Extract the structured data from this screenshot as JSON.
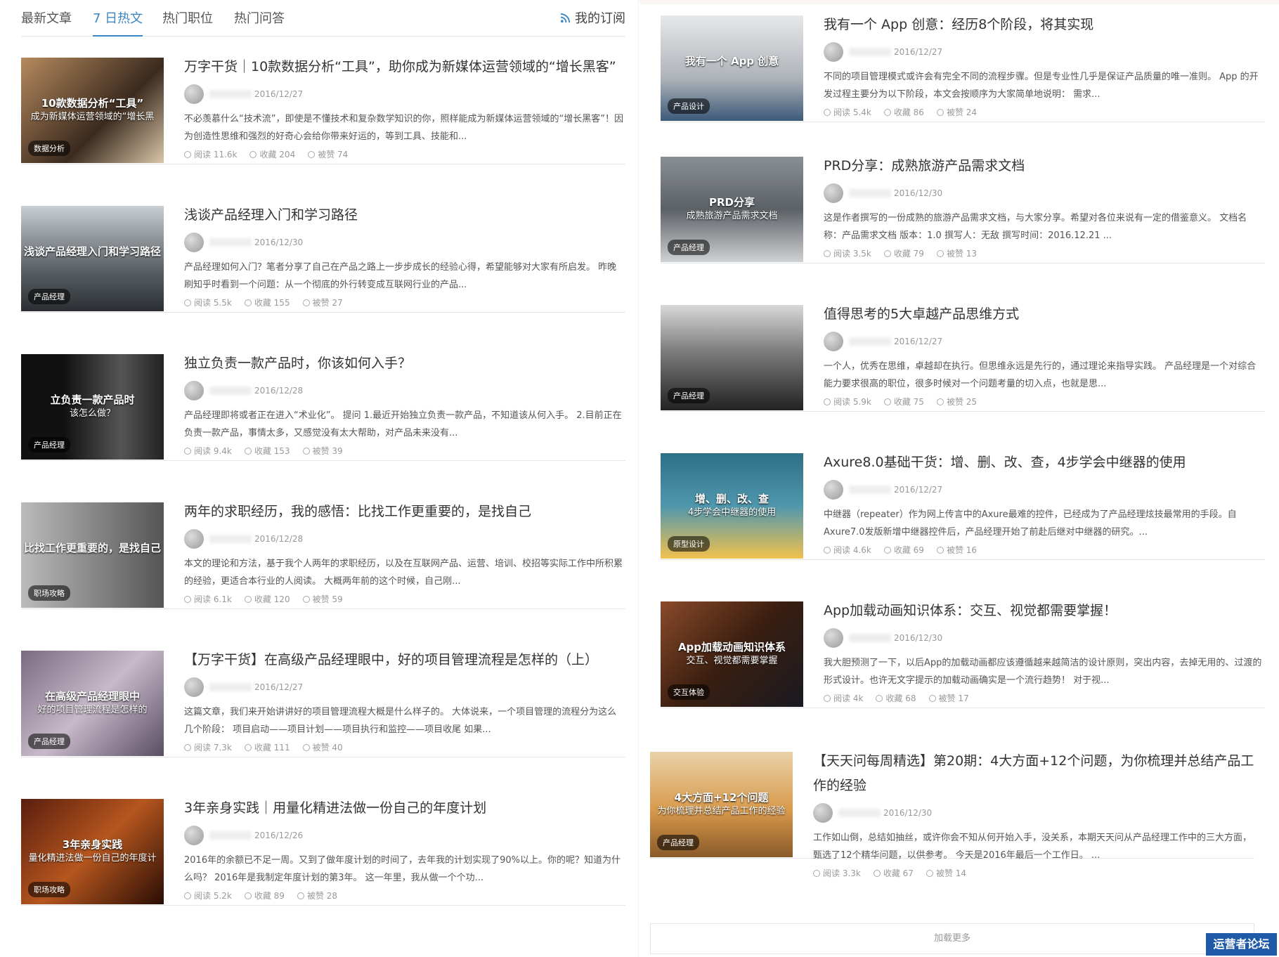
{
  "tabs": [
    "最新文章",
    "7 日热文",
    "热门职位",
    "热门问答"
  ],
  "subscribe": "我的订阅",
  "load_more": "加载更多",
  "logo_text": "运营者论坛",
  "left": [
    {
      "title": "万字干货｜10款数据分析“工具”，助你成为新媒体运营领域的“增长黑客”",
      "date": "2016/12/27",
      "summary": "不必羡慕什么“技术流”，即使是不懂技术和复杂数学知识的你，照样能成为新媒体运营领域的“增长黑客”！因为创造性思维和强烈的好奇心会给你带来好运的，等到工具、技能和...",
      "reads": "阅读 11.6k",
      "favs": "收藏 204",
      "likes": "被赞 74",
      "overlay": "10款数据分析“工具”",
      "overlay2": "成为新媒体运营领域的“增长黑",
      "badge": "数据分析",
      "bg": "linear-gradient(135deg,#b58a5e,#3b2a1e 60%,#d9c6a8)"
    },
    {
      "title": "浅谈产品经理入门和学习路径",
      "date": "2016/12/30",
      "summary": "产品经理如何入门？笔者分享了自己在产品之路上一步步成长的经验心得，希望能够对大家有所启发。 昨晚刷知乎时看到一个问题：从一个彻底的外行转变成互联网行业的产品...",
      "reads": "阅读 5.5k",
      "favs": "收藏 155",
      "likes": "被赞 27",
      "overlay": "浅谈产品经理入门和学习路径",
      "overlay2": "",
      "badge": "产品经理",
      "bg": "linear-gradient(180deg,#c9ced2,#5b6166 60%,#2b2f33)"
    },
    {
      "title": "独立负责一款产品时，你该如何入手？",
      "date": "2016/12/28",
      "summary": "产品经理即将或者正在进入“术业化”。 提问 1.最近开始独立负责一款产品，不知道该从何入手。 2.目前正在负责一款产品，事情太多，又感觉没有太大帮助，对产品未来没有...",
      "reads": "阅读 9.4k",
      "favs": "收藏 153",
      "likes": "被赞 39",
      "overlay": "立负责一款产品时",
      "overlay2": "该怎么做？",
      "badge": "产品经理",
      "bg": "linear-gradient(90deg,#111 30%,#555 70%,#222)"
    },
    {
      "title": "两年的求职经历，我的感悟：比找工作更重要的，是找自己",
      "date": "2016/12/28",
      "summary": "本文的理论和方法，基于我个人两年的求职经历，以及在互联网产品、运营、培训、校招等实际工作中所积累的经验，更适合本行业的人阅读。 大概两年前的这个时候，自己刚...",
      "reads": "阅读 6.1k",
      "favs": "收藏 120",
      "likes": "被赞 59",
      "overlay": "比找工作更重要的，是找自己",
      "overlay2": "",
      "badge": "职场攻略",
      "bg": "linear-gradient(90deg,#bbb,#888 50%,#555)"
    },
    {
      "title": "【万字干货】在高级产品经理眼中，好的项目管理流程是怎样的（上）",
      "date": "2016/12/27",
      "summary": "这篇文章，我们来开始讲讲好的项目管理流程大概是什么样子的。 大体说来，一个项目管理的流程分为这么几个阶段： 项目启动——项目计划——项目执行和监控——项目收尾 如果...",
      "reads": "阅读 7.3k",
      "favs": "收藏 111",
      "likes": "被赞 40",
      "overlay": "在高级产品经理眼中",
      "overlay2": "好的项目管理流程是怎样的",
      "badge": "产品经理",
      "bg": "linear-gradient(135deg,#7a6a80,#c7b9c9 50%,#5a4e63)"
    },
    {
      "title": "3年亲身实践｜用量化精进法做一份自己的年度计划",
      "date": "2016/12/26",
      "summary": "2016年的余额已不足一周。又到了做年度计划的时间了，去年我的计划实现了90%以上。你的呢？知道为什么吗？ 2016年是我制定年度计划的第3年。 这一年里，我从做一个个功...",
      "reads": "阅读 5.2k",
      "favs": "收藏 89",
      "likes": "被赞 28",
      "overlay": "3年亲身实践",
      "overlay2": "量化精进法做一份自己的年度计",
      "badge": "职场攻略",
      "bg": "linear-gradient(135deg,#5a1e0e,#b5561e 50%,#2a0d05)"
    }
  ],
  "right": [
    {
      "title": "我有一个 App 创意：经历8个阶段，将其实现",
      "date": "2016/12/27",
      "summary": "不同的项目管理模式或许会有完全不同的流程步骤。但是专业性几乎是保证产品质量的唯一准则。 App 的开发过程主要分为以下阶段，本文会按顺序为大家简单地说明： 需求...",
      "reads": "阅读 5.4k",
      "favs": "收藏 86",
      "likes": "被赞 24",
      "overlay": "我有一个 App 创意",
      "overlay2": "",
      "badge": "产品设计",
      "bg": "linear-gradient(180deg,#e6e8ea,#aeb3b8 60%,#3c5a7a)"
    },
    {
      "title": "PRD分享：成熟旅游产品需求文档",
      "date": "2016/12/30",
      "summary": "这是作者撰写的一份成熟的旅游产品需求文档，与大家分享。希望对各位来说有一定的借鉴意义。 文档名称：产品需求文档 版本：1.0 撰写人：无敌 撰写时间：2016.12.21 ...",
      "reads": "阅读 3.5k",
      "favs": "收藏 79",
      "likes": "被赞 13",
      "overlay": "PRD分享",
      "overlay2": "成熟旅游产品需求文档",
      "badge": "产品经理",
      "bg": "linear-gradient(180deg,#8a8f93,#5c6166 50%,#cfd2d4)"
    },
    {
      "title": "值得思考的5大卓越产品思维方式",
      "date": "2016/12/27",
      "summary": "一个人，优秀在思维，卓越却在执行。但思维永远是先行的，通过理论来指导实践。 产品经理是一个对综合能力要求很高的职位，很多时候对一个问题考量的切入点，也就是思...",
      "reads": "阅读 5.9k",
      "favs": "收藏 75",
      "likes": "被赞 25",
      "overlay": "",
      "overlay2": "",
      "badge": "产品经理",
      "bg": "linear-gradient(180deg,#d9d9d9,#7a7a7a 45%,#222)"
    },
    {
      "title": "Axure8.0基础干货：增、删、改、查，4步学会中继器的使用",
      "date": "2016/12/27",
      "summary": "中继器（repeater）作为网上传言中的Axure最难的控件，已经成为了产品经理炫技最常用的手段。自Axure7.0发版新增中继器控件后，产品经理开始了前赴后继对中继器的研究。...",
      "reads": "阅读 4.6k",
      "favs": "收藏 69",
      "likes": "被赞 16",
      "overlay": "增、删、改、查",
      "overlay2": "4步学会中继器的使用",
      "badge": "原型设计",
      "bg": "linear-gradient(180deg,#2e6f86,#4f97ad 50%,#f2c14e)"
    },
    {
      "title": "App加载动画知识体系：交互、视觉都需要掌握！",
      "date": "2016/12/30",
      "summary": "我大胆预测了一下，以后App的加载动画都应该遵循越来越简洁的设计原则，突出内容，去掉无用的、过渡的形式设计。也许无文字提示的加载动画确实是一个流行趋势！ 对于视...",
      "reads": "阅读 4k",
      "favs": "收藏 68",
      "likes": "被赞 17",
      "overlay": "App加载动画知识体系",
      "overlay2": "交互、视觉都需要掌握",
      "badge": "交互体验",
      "bg": "linear-gradient(135deg,#8a4a2a,#3a1e10 50%,#1a1a22)"
    },
    {
      "title": "【天天问每周精选】第20期：4大方面+12个问题，为你梳理并总结产品工作的经验",
      "date": "2016/12/30",
      "summary": "工作如山倒，总结如抽丝，或许你会不知从何开始入手，没关系，本期天天问从产品经理工作中的三大方面，甄选了12个精华问题，以供参考。 今天是2016年最后一个工作日。 ...",
      "reads": "阅读 3.3k",
      "favs": "收藏 67",
      "likes": "被赞 14",
      "overlay": "4大方面+12个问题",
      "overlay2": "为你梳理并总结产品工作的经验",
      "badge": "产品经理",
      "bg": "linear-gradient(180deg,#e9d2a8,#d89a4c 55%,#8a5a2a)"
    }
  ]
}
